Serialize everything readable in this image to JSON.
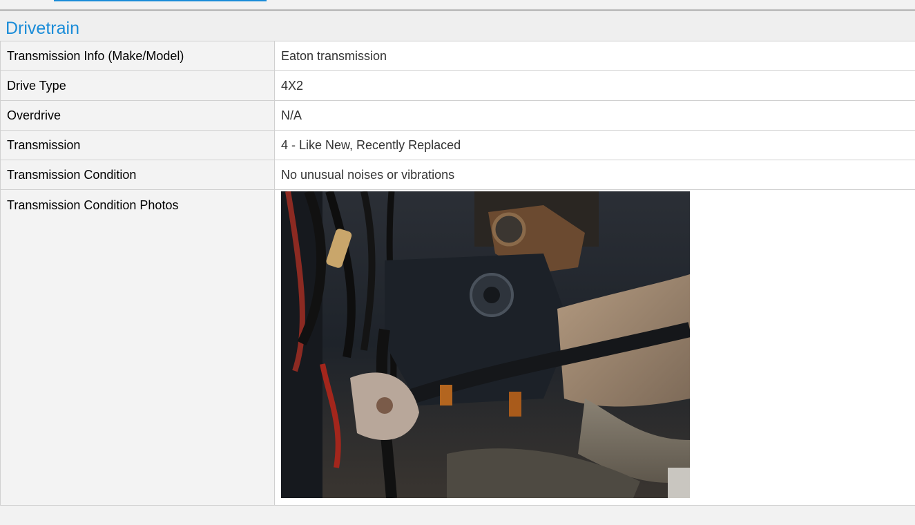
{
  "section": {
    "title": "Drivetrain"
  },
  "fields": [
    {
      "label": "Transmission Info (Make/Model)",
      "value": "Eaton transmission"
    },
    {
      "label": "Drive Type",
      "value": "4X2"
    },
    {
      "label": "Overdrive",
      "value": "N/A"
    },
    {
      "label": "Transmission",
      "value": "4 - Like New, Recently Replaced"
    },
    {
      "label": "Transmission Condition",
      "value": "No unusual noises or vibrations"
    }
  ],
  "photos_field": {
    "label": "Transmission Condition Photos",
    "photo_subject": "truck undercarriage transmission photo"
  },
  "colors": {
    "accent": "#1a8cd8",
    "label_background": "#f3f3f3",
    "value_background": "#ffffff",
    "border": "#d0d0d0"
  }
}
